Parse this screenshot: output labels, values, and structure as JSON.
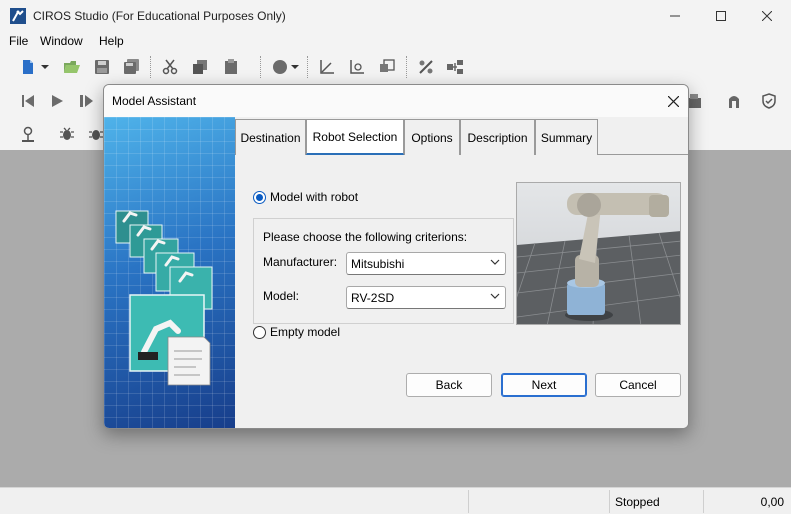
{
  "window": {
    "title": "CIROS Studio (For Educational Purposes Only)"
  },
  "menu": {
    "items": [
      "File",
      "Window",
      "Help"
    ]
  },
  "status_bar": {
    "status": "Stopped",
    "value": "0,00"
  },
  "dialog": {
    "title": "Model Assistant",
    "tabs": [
      {
        "label": "Destination",
        "active": false
      },
      {
        "label": "Robot Selection",
        "active": true
      },
      {
        "label": "Options",
        "active": false
      },
      {
        "label": "Description",
        "active": false
      },
      {
        "label": "Summary",
        "active": false
      }
    ],
    "model_with_robot": {
      "label": "Model with robot",
      "selected": true
    },
    "criteria_label": "Please choose the following criterions:",
    "manufacturer": {
      "label": "Manufacturer:",
      "value": "Mitsubishi"
    },
    "model": {
      "label": "Model:",
      "value": "RV-2SD"
    },
    "empty_model": {
      "label": "Empty model",
      "selected": false
    },
    "buttons": {
      "back": "Back",
      "next": "Next",
      "cancel": "Cancel"
    }
  },
  "colors": {
    "accent": "#0a5bc2",
    "side_gradient_top": "#4fb3ea",
    "side_gradient_bottom": "#173d8a",
    "workspace": "#ababab"
  }
}
